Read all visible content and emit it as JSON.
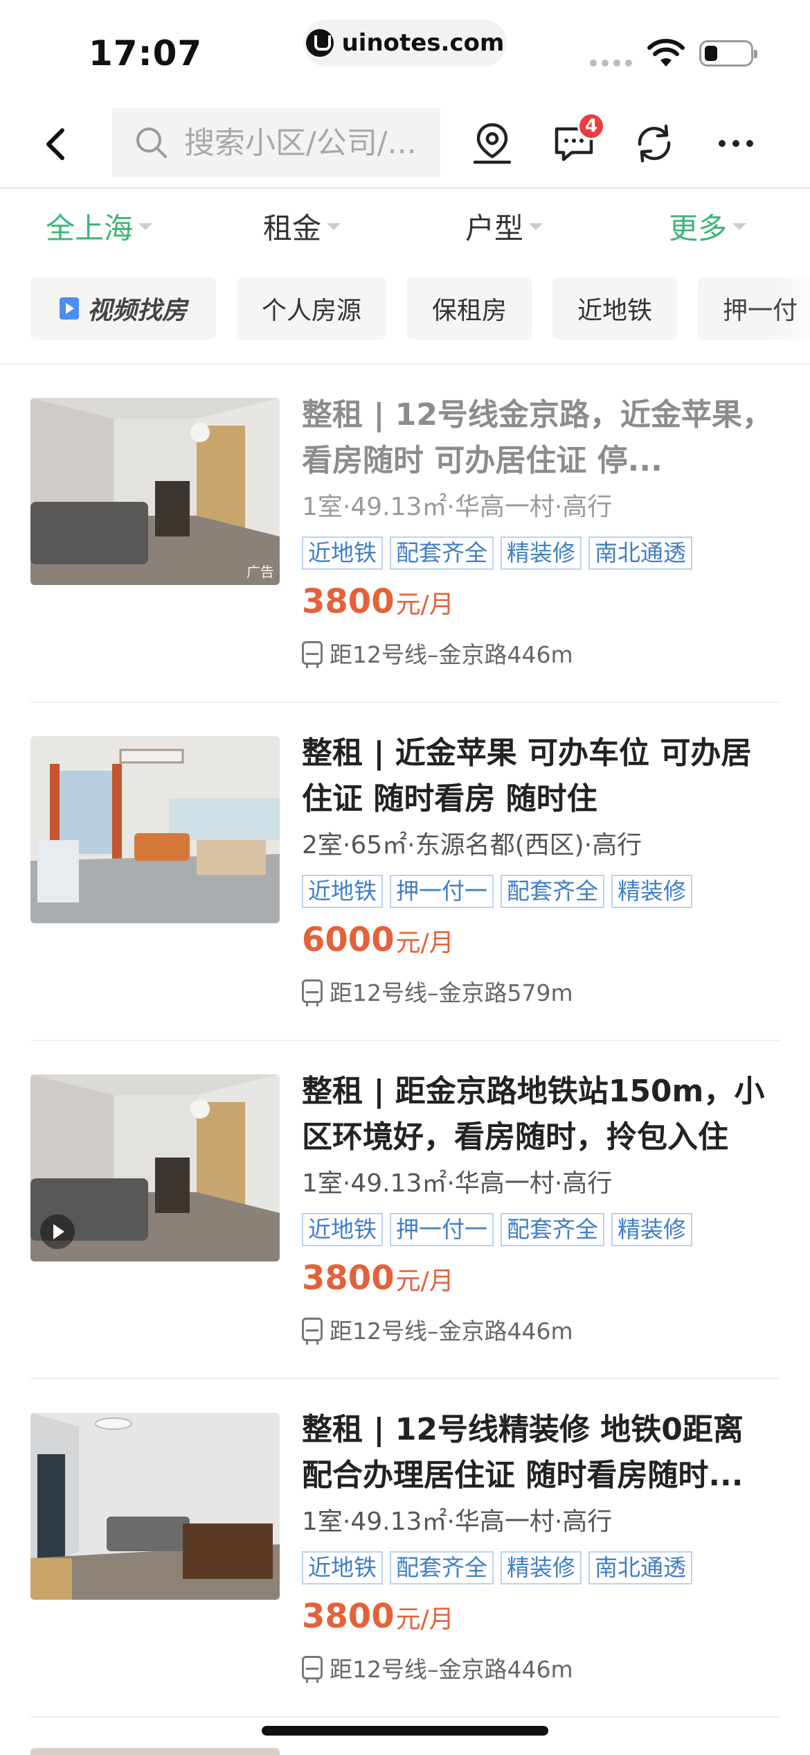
{
  "status_bar": {
    "time": "17:07",
    "url": "uinotes.com"
  },
  "nav": {
    "search_placeholder": "搜索小区/公司/...",
    "message_badge": "4"
  },
  "filters": [
    {
      "label": "全上海",
      "active": true
    },
    {
      "label": "租金",
      "active": false
    },
    {
      "label": "户型",
      "active": false
    },
    {
      "label": "更多",
      "active": true
    }
  ],
  "quick_tags": [
    "视频找房",
    "个人房源",
    "保租房",
    "近地铁",
    "押一付"
  ],
  "listings": [
    {
      "title": "整租 | 12号线金京路，近金苹果，看房随时 可办居住证 停...",
      "meta": "1室·49.13㎡·华高一村·高行",
      "tags": [
        "近地铁",
        "配套齐全",
        "精装修",
        "南北通透"
      ],
      "price": "3800",
      "price_unit": "元/月",
      "subway": "距12号线–金京路446m",
      "ad_label": "广告"
    },
    {
      "title": "整租 | 近金苹果  可办车位  可办居住证  随时看房  随时住",
      "meta": "2室·65㎡·东源名都(西区)·高行",
      "tags": [
        "近地铁",
        "押一付一",
        "配套齐全",
        "精装修"
      ],
      "price": "6000",
      "price_unit": "元/月",
      "subway": "距12号线–金京路579m"
    },
    {
      "title": "整租 | 距金京路地铁站150m，小区环境好，看房随时，拎包入住",
      "meta": "1室·49.13㎡·华高一村·高行",
      "tags": [
        "近地铁",
        "押一付一",
        "配套齐全",
        "精装修"
      ],
      "price": "3800",
      "price_unit": "元/月",
      "subway": "距12号线–金京路446m"
    },
    {
      "title": "整租 | 12号线精装修 地铁0距离 配合办理居住证 随时看房随时...",
      "meta": "1室·49.13㎡·华高一村·高行",
      "tags": [
        "近地铁",
        "配套齐全",
        "精装修",
        "南北通透"
      ],
      "price": "3800",
      "price_unit": "元/月",
      "subway": "距12号线–金京路446m"
    }
  ],
  "colors": {
    "accent_green": "#3bb579",
    "price_orange": "#e4613a",
    "tag_blue": "#3f7fc6",
    "badge_red": "#ef3b3b"
  },
  "icons": [
    "back-icon",
    "search-icon",
    "location-pin-icon",
    "message-icon",
    "refresh-icon",
    "more-icon",
    "wifi-icon",
    "battery-icon",
    "play-icon",
    "subway-icon"
  ]
}
